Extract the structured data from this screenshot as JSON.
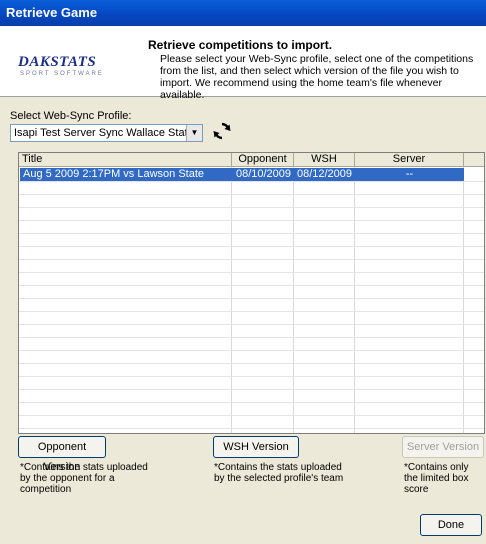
{
  "window": {
    "title": "Retrieve Game"
  },
  "header": {
    "logo_brand": "DAKSTATS",
    "logo_sub": "SPORT SOFTWARE",
    "title": "Retrieve competitions to import.",
    "description": "Please select your Web-Sync profile, select one of the competitions from the list, and then select which version of the file you wish to import. We recommend using the home team's file whenever available."
  },
  "profile": {
    "label": "Select Web-Sync Profile:",
    "selected": "Isapi Test Server Sync Wallace State -"
  },
  "table": {
    "columns": [
      "Title",
      "Opponent",
      "WSH",
      "Server"
    ],
    "rows": [
      {
        "title": "Aug 5 2009  2:17PM vs Lawson State",
        "opponent": "08/10/2009",
        "wsh": "08/12/2009",
        "server": "--"
      }
    ]
  },
  "buttons": {
    "opponent_version": "Opponent Version",
    "wsh_version": "WSH Version",
    "server_version": "Server Version",
    "done": "Done"
  },
  "notes": {
    "opponent": "*Contains the stats uploaded by the opponent for a competition",
    "wsh": "*Contains the stats uploaded by the selected profile's team",
    "server": "*Contains only the limited box score"
  },
  "colors": {
    "titlebar": "#0546c0",
    "selection": "#316ac5",
    "dialog_bg": "#ece9d8"
  },
  "icons": {
    "refresh": "refresh-icon",
    "dropdown": "chevron-down-icon"
  }
}
